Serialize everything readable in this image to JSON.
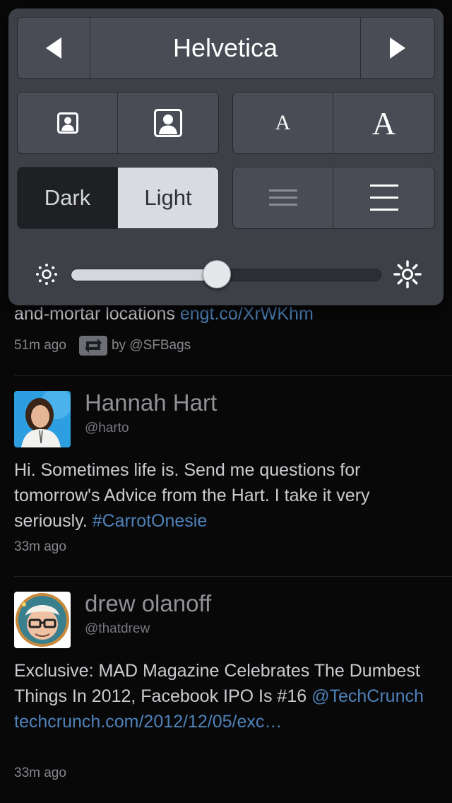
{
  "popover": {
    "font_name": "Helvetica",
    "prev_icon": "triangle-left-icon",
    "next_icon": "triangle-right-icon",
    "avatar_small_icon": "avatar-small-icon",
    "avatar_large_icon": "avatar-large-icon",
    "font_small_label": "A",
    "font_large_label": "A",
    "theme_dark_label": "Dark",
    "theme_light_label": "Light",
    "spacing_tight_icon": "lines-tight-icon",
    "spacing_loose_icon": "lines-loose-icon",
    "brightness_low_icon": "sun-small-icon",
    "brightness_high_icon": "sun-large-icon",
    "brightness_level": 0.47,
    "selected_theme": "Light"
  },
  "timeline": {
    "partial_tweet": {
      "text": "and-mortar locations ",
      "link": "engt.co/XrWKhm",
      "time": "51m ago",
      "retweet_icon": "retweet-icon",
      "retweeted_by": "by @SFBags"
    },
    "tweets": [
      {
        "name": "Hannah Hart",
        "handle": "@harto",
        "text_plain": "Hi. Sometimes life is. Send me questions for tomorrow's Advice from the Hart. I take it very seriously. ",
        "text_link": "#CarrotOnesie",
        "time": "33m ago",
        "avatar_color": "#2d9fe0"
      },
      {
        "name": "drew olanoff",
        "handle": "@thatdrew",
        "text_plain": "Exclusive: MAD Magazine Celebrates The Dumbest Things In 2012, Facebook IPO Is #16 ",
        "text_link": "@TechCrunch techcrunch.com/2012/12/05/exc…",
        "time": "33m ago",
        "avatar_color": "#3a7f8e"
      }
    ]
  },
  "colors": {
    "link": "#4f82b9",
    "background": "#080809",
    "popover": "#3e4048"
  }
}
